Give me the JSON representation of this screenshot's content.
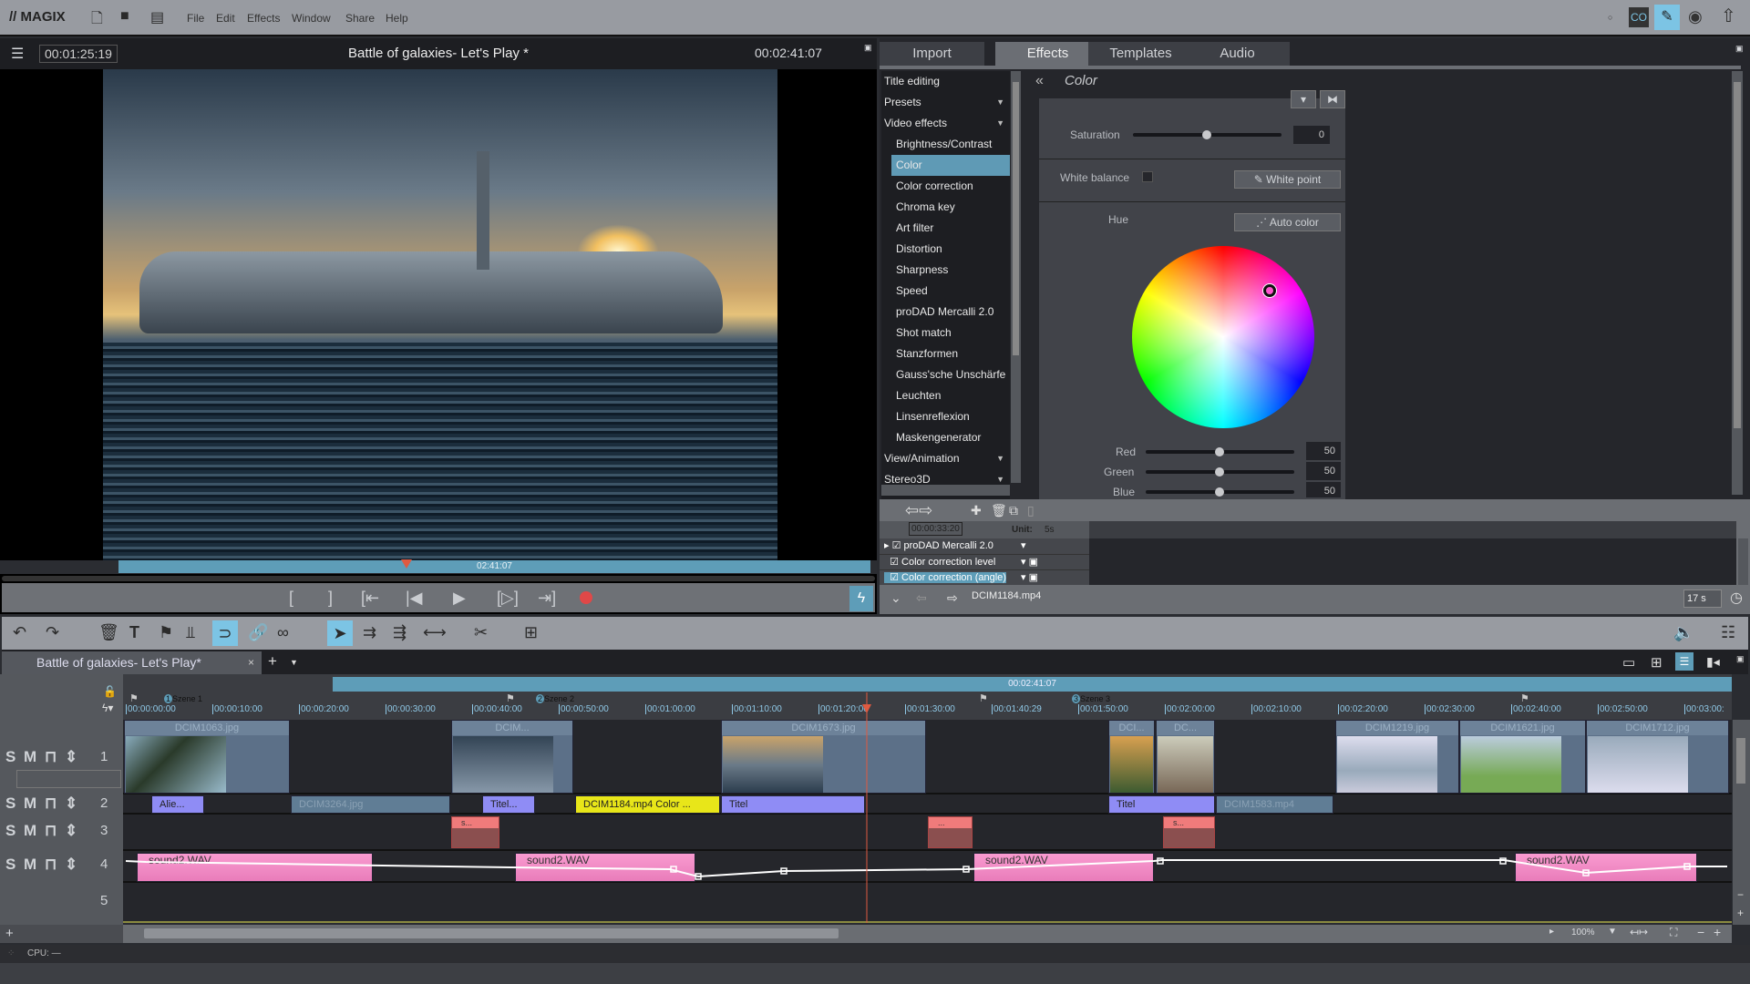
{
  "menubar": {
    "logo": "// MAGIX",
    "items": [
      "File",
      "Edit",
      "Effects",
      "Window",
      "Share",
      "Help"
    ]
  },
  "preview": {
    "current_time": "00:01:25:19",
    "title": "Battle of galaxies- Let's Play *",
    "duration": "00:02:41:07",
    "range_label": "02:41:07"
  },
  "right_tabs": [
    "Import",
    "Effects",
    "Templates",
    "Audio"
  ],
  "effects_list": [
    {
      "label": "Title editing",
      "level": 0
    },
    {
      "label": "Presets",
      "level": 0,
      "arrow": "▼"
    },
    {
      "label": "Video effects",
      "level": 0,
      "arrow": "▼"
    },
    {
      "label": "Brightness/Contrast",
      "level": 1
    },
    {
      "label": "Color",
      "level": 1,
      "selected": true
    },
    {
      "label": "Color correction",
      "level": 1
    },
    {
      "label": "Chroma key",
      "level": 1
    },
    {
      "label": "Art filter",
      "level": 1
    },
    {
      "label": "Distortion",
      "level": 1
    },
    {
      "label": "Sharpness",
      "level": 1
    },
    {
      "label": "Speed",
      "level": 1
    },
    {
      "label": "proDAD Mercalli 2.0",
      "level": 1
    },
    {
      "label": "Shot match",
      "level": 1
    },
    {
      "label": "Stanzformen",
      "level": 1
    },
    {
      "label": "Gauss'sche Unschärfe",
      "level": 1
    },
    {
      "label": "Leuchten",
      "level": 1
    },
    {
      "label": "Linsenreflexion",
      "level": 1
    },
    {
      "label": "Maskengenerator",
      "level": 1
    },
    {
      "label": "View/Animation",
      "level": 0,
      "arrow": "▼"
    },
    {
      "label": "Stereo3D",
      "level": 0,
      "arrow": "▼"
    }
  ],
  "color_panel": {
    "title": "Color",
    "saturation_label": "Saturation",
    "saturation": "0",
    "saturation_pos": 0.5,
    "white_balance_label": "White balance",
    "white_point_label": "White point",
    "hue_label": "Hue",
    "auto_color_label": "Auto color",
    "channels": [
      {
        "label": "Red",
        "value": "50"
      },
      {
        "label": "Green",
        "value": "50"
      },
      {
        "label": "Blue",
        "value": "50"
      }
    ]
  },
  "keyframes": {
    "timecode": "00:00:33:20",
    "unit_label": "Unit:",
    "unit": "5s",
    "rows": [
      {
        "label": "proDAD Mercalli 2.0"
      },
      {
        "label": "Color correction level"
      },
      {
        "label": "Color correction (angle)",
        "selected": true
      }
    ],
    "object": "DCIM1184.mp4",
    "length": "17 s"
  },
  "project_tab": "Battle of galaxies- Let's Play*",
  "timeline": {
    "range_label": "00:02:41:07",
    "scenes": [
      {
        "label": "Szene 1",
        "num": "1"
      },
      {
        "label": "Szene 2",
        "num": "2"
      },
      {
        "label": "Szene 3",
        "num": "3"
      }
    ],
    "ticks": [
      "00:00:00:00",
      "00:00:10:00",
      "00:00:20:00",
      "00:00:30:00",
      "00:00:40:00",
      "00:00:50:00",
      "00:01:00:00",
      "00:01:10:00",
      "00:01:20:00",
      "00:01:30:00",
      "00:01:40:29",
      "00:01:50:00",
      "00:02:00:00",
      "00:02:10:00",
      "00:02:20:00",
      "00:02:30:00",
      "00:02:40:00",
      "00:02:50:00",
      "00:03:00:"
    ],
    "tracks": [
      "1",
      "2",
      "3",
      "4",
      "5"
    ],
    "track_controls": "S M",
    "video_clips": [
      "DCIM1063.jpg",
      "DCIM...",
      "DCIM1673.jpg",
      "...",
      "DCI...",
      "DC...",
      "DCIM1219.jpg",
      "DCIM1621.jpg",
      "DCIM1712.jpg"
    ],
    "track2_clips": [
      "Alie...",
      "DCIM3264.jpg",
      "Titel...",
      "DCIM1184.mp4  Color ...",
      "Titel",
      "Titel",
      "DCIM1583.mp4"
    ],
    "track3_clips": [
      "s...",
      "...",
      "s..."
    ],
    "audio_clips": [
      "sound2.WAV",
      "sound2.WAV",
      "sound2.WAV",
      "sound2.WAV"
    ],
    "zoom": "100%"
  },
  "status": {
    "cpu": "CPU: —"
  }
}
